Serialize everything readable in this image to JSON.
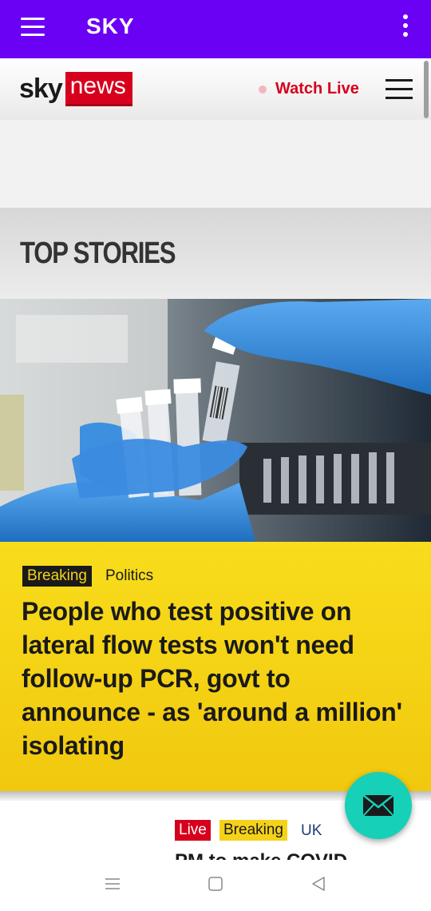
{
  "app_bar": {
    "title": "SKY",
    "menu_icon": "hamburger-icon",
    "more_icon": "more-vertical-icon"
  },
  "sky_header": {
    "logo_sky": "sky",
    "logo_news": "news",
    "watch_live": "Watch Live",
    "menu_icon": "hamburger-icon"
  },
  "section": {
    "title": "TOP STORIES"
  },
  "top_story": {
    "image": "lab-gloved-hands-test-tubes",
    "tag": "Breaking",
    "category": "Politics",
    "headline": "People who test positive on lateral flow tests won't need follow-up PCR, govt to announce - as 'around a million' isolating"
  },
  "next_story": {
    "tag_live": "Live",
    "tag_breaking": "Breaking",
    "category": "UK",
    "headline_partial": "PM to make COVID"
  },
  "fab": {
    "icon": "mail-icon"
  },
  "system_nav": {
    "recents": "recents-icon",
    "home": "home-icon",
    "back": "back-icon"
  },
  "colors": {
    "app_bar": "#6a00f4",
    "sky_red": "#d6001c",
    "breaking_yellow": "#f5d21a",
    "fab_teal": "#17d0b8"
  }
}
